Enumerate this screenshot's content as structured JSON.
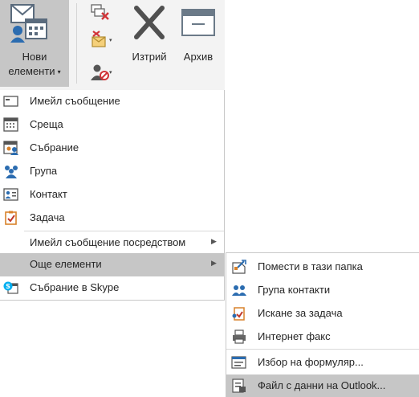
{
  "ribbon": {
    "new_items_line1": "Нови",
    "new_items_line2": "елементи",
    "delete_label": "Изтрий",
    "archive_label": "Архив",
    "caret": "▾"
  },
  "menu": {
    "items": [
      {
        "label": "Имейл съобщение",
        "icon": "email-message-icon"
      },
      {
        "label": "Среща",
        "icon": "calendar-appointment-icon"
      },
      {
        "label": "Събрание",
        "icon": "meeting-icon"
      },
      {
        "label": "Група",
        "icon": "group-icon"
      },
      {
        "label": "Контакт",
        "icon": "contact-card-icon"
      },
      {
        "label": "Задача",
        "icon": "task-icon"
      },
      {
        "label": "Имейл съобщение посредством",
        "icon": ""
      },
      {
        "label": "Още елементи",
        "icon": ""
      },
      {
        "label": "Събрание в Skype",
        "icon": "skype-meeting-icon"
      }
    ],
    "arrow": "▶"
  },
  "submenu": {
    "items": [
      {
        "label": "Помести в тази папка",
        "icon": "post-in-folder-icon"
      },
      {
        "label": "Група контакти",
        "icon": "contact-group-icon"
      },
      {
        "label": "Искане за задача",
        "icon": "task-request-icon"
      },
      {
        "label": "Интернет факс",
        "icon": "fax-icon"
      },
      {
        "label": "Избор на формуляр...",
        "icon": "choose-form-icon"
      },
      {
        "label": "Файл с данни на Outlook...",
        "icon": "outlook-data-file-icon"
      }
    ]
  },
  "colors": {
    "highlight": "#c6c6c6",
    "ribbon_bg": "#f3f3f3",
    "accent_blue": "#2b6cb0"
  }
}
